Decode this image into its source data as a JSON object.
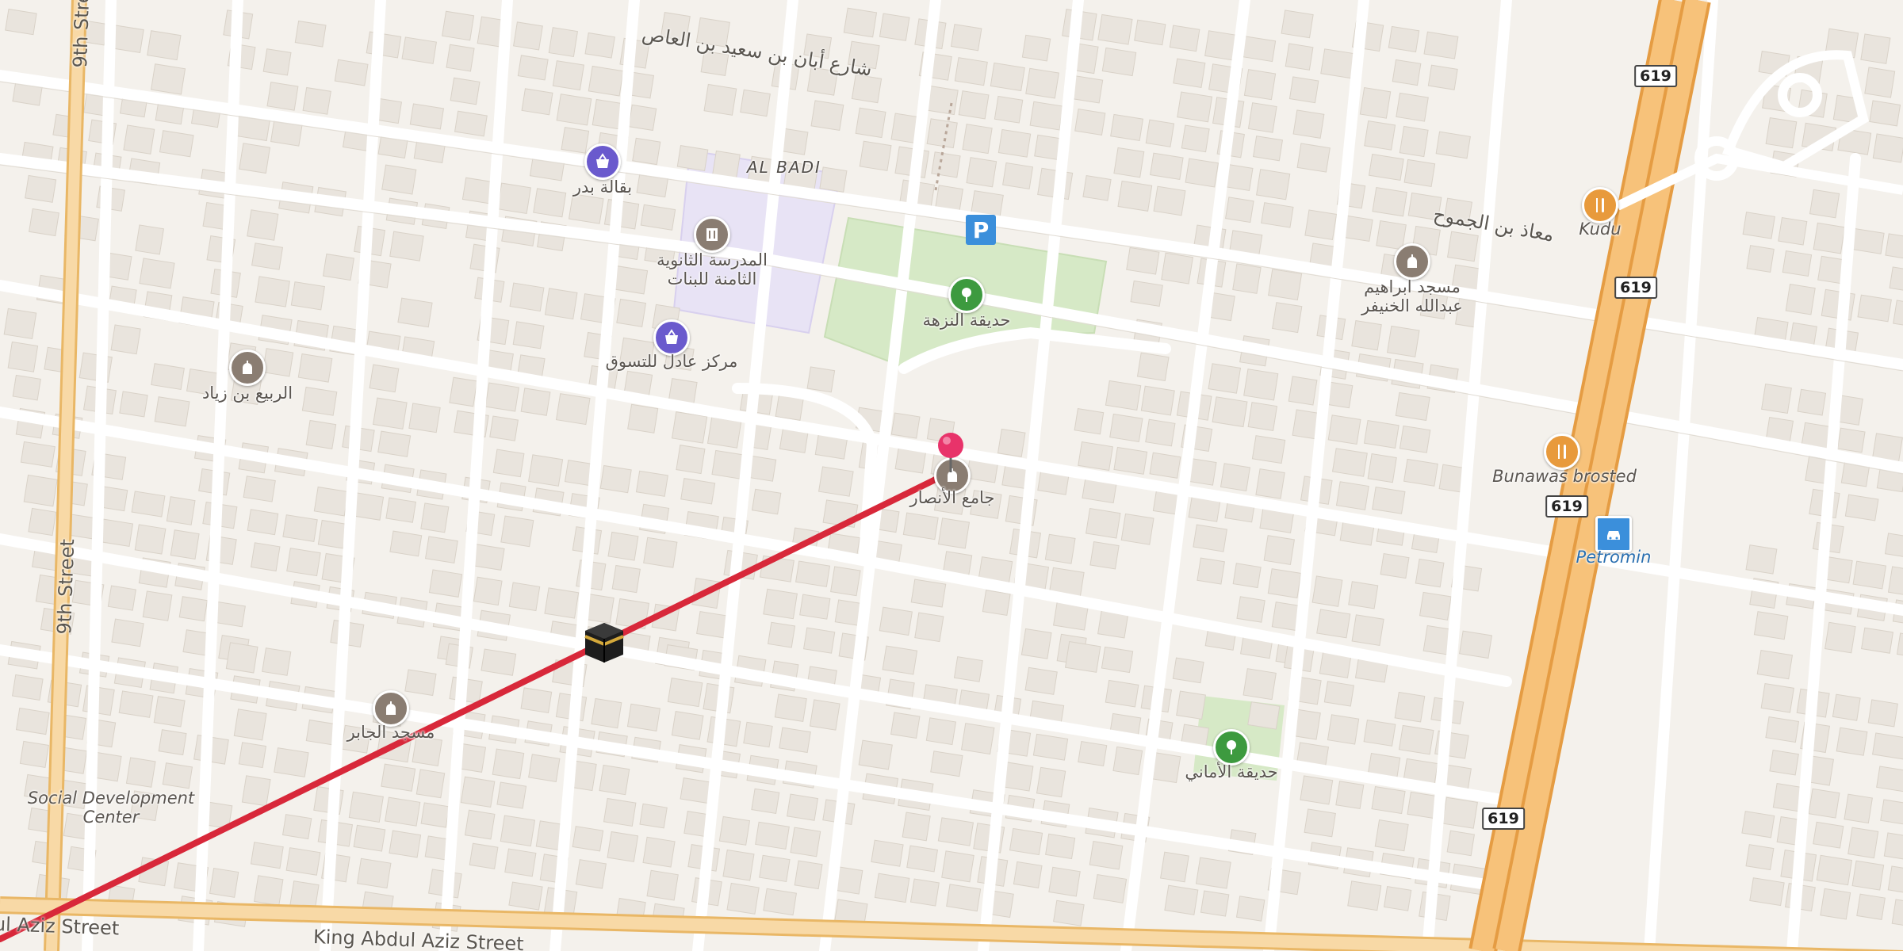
{
  "map": {
    "district": "AL BADI",
    "streets": {
      "ninth_top": "9th Street",
      "ninth_bottom": "9th Street",
      "abdul_aziz_left": "ul Aziz Street",
      "abdul_aziz_right": "King Abdul Aziz Street",
      "aban": "شارع أبان بن سعيد بن العاص",
      "muaz": "معاذ بن الجموح"
    },
    "road_shield": "619",
    "places": {
      "grocery_badr": "بقالة بدر",
      "girls_school": "المدرسة الثانوية\nالثامنة للبنات",
      "park_nuzha": "حديقة النزهة",
      "adel_center": "مركز عادل للتسوق",
      "mosque_rabie": "الربيع بن زياد",
      "mosque_ibrahim": "مسجد ابراهيم\nعبدالله الخنيفر",
      "kudu": "Kudu",
      "jame_alansar": "جامع الأنصار",
      "bunawas": "Bunawas brosted",
      "petromin": "Petromin",
      "park_amani": "حديقة الأماني",
      "mosque_jaber": "مسجد الجابر",
      "social_center": "Social Development\nCenter"
    },
    "icons": {
      "shop": "shopping-basket-icon",
      "school": "school-icon",
      "park": "tree-icon",
      "mosque": "mosque-icon",
      "food": "restaurant-icon",
      "fuel": "car-service-icon",
      "parking": "parking-icon",
      "pin": "location-pin-icon",
      "qibla": "kaaba-icon"
    },
    "colors": {
      "qibla_line": "#d8283a",
      "pin": "#e8336a",
      "highway": "#f7c27a",
      "park": "#d6e9c6",
      "school_area": "#e8e3f5",
      "shop_poi": "#6a5acd",
      "mosque_poi": "#8a7d72",
      "food_poi": "#e89a3c",
      "park_poi": "#3d9a3f",
      "parking": "#3b8fdb"
    }
  }
}
